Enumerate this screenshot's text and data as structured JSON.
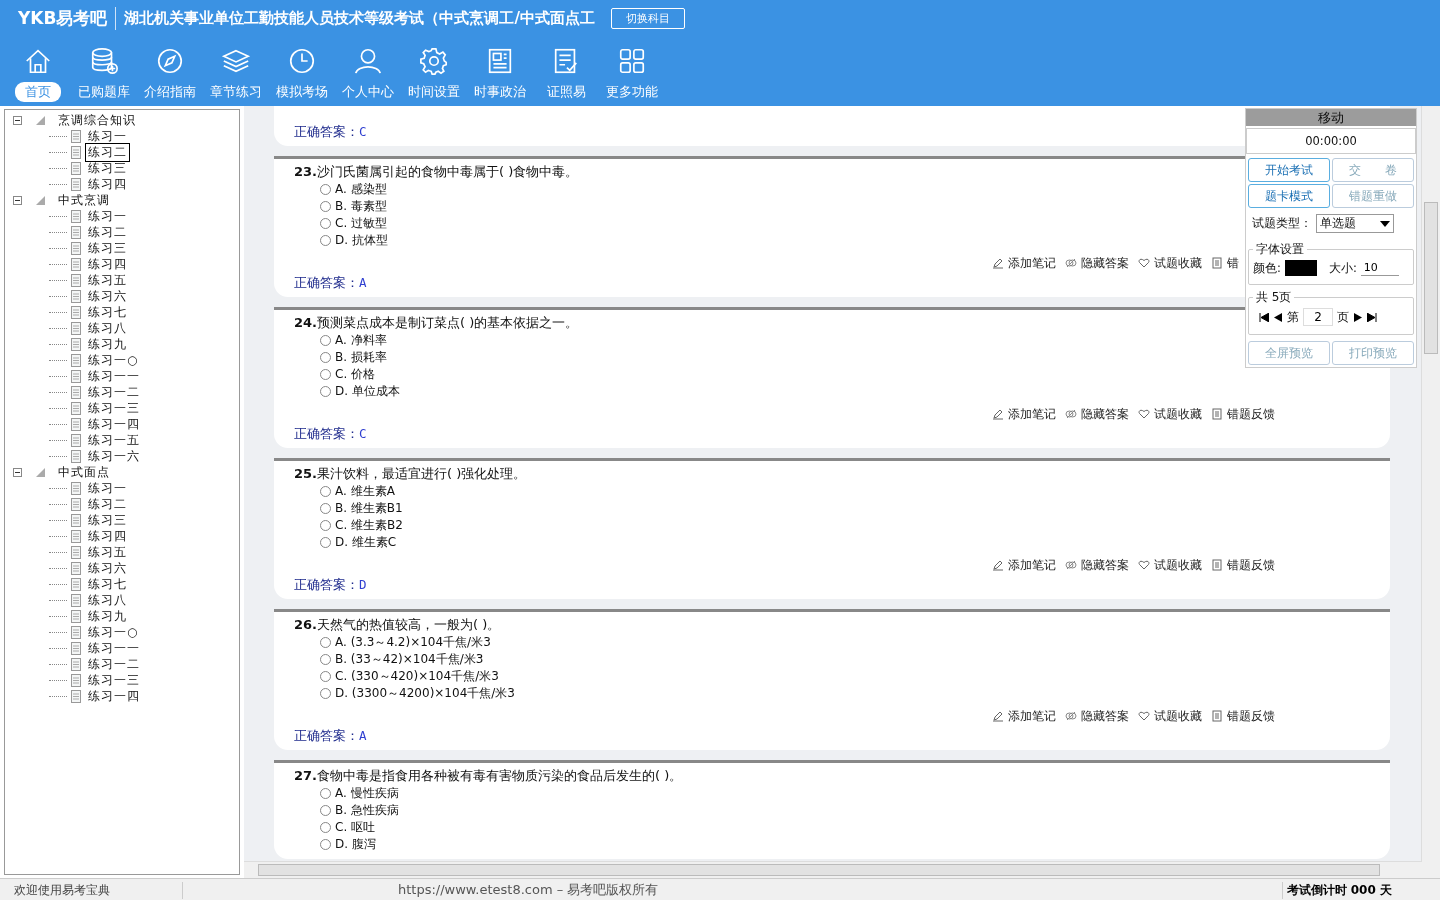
{
  "header": {
    "logo": "YKB易考吧",
    "title": "湖北机关事业单位工勤技能人员技术等级考试（中式烹调工/中式面点工",
    "switch_button": "切换科目"
  },
  "nav": [
    {
      "label": "首页",
      "selected": true
    },
    {
      "label": "已购题库",
      "selected": false
    },
    {
      "label": "介绍指南",
      "selected": false
    },
    {
      "label": "章节练习",
      "selected": false
    },
    {
      "label": "模拟考场",
      "selected": false
    },
    {
      "label": "个人中心",
      "selected": false
    },
    {
      "label": "时间设置",
      "selected": false
    },
    {
      "label": "时事政治",
      "selected": false
    },
    {
      "label": "证照易",
      "selected": false
    },
    {
      "label": "更多功能",
      "selected": false
    }
  ],
  "tree": [
    {
      "label": "烹调综合知识",
      "expanded": true,
      "children": [
        {
          "label": "练习一",
          "selected": false
        },
        {
          "label": "练习二",
          "selected": true
        },
        {
          "label": "练习三",
          "selected": false
        },
        {
          "label": "练习四",
          "selected": false
        }
      ]
    },
    {
      "label": "中式烹调",
      "expanded": true,
      "children": [
        {
          "label": "练习一",
          "selected": false
        },
        {
          "label": "练习二",
          "selected": false
        },
        {
          "label": "练习三",
          "selected": false
        },
        {
          "label": "练习四",
          "selected": false
        },
        {
          "label": "练习五",
          "selected": false
        },
        {
          "label": "练习六",
          "selected": false
        },
        {
          "label": "练习七",
          "selected": false
        },
        {
          "label": "练习八",
          "selected": false
        },
        {
          "label": "练习九",
          "selected": false
        },
        {
          "label": "练习一○",
          "selected": false
        },
        {
          "label": "练习一一",
          "selected": false
        },
        {
          "label": "练习一二",
          "selected": false
        },
        {
          "label": "练习一三",
          "selected": false
        },
        {
          "label": "练习一四",
          "selected": false
        },
        {
          "label": "练习一五",
          "selected": false
        },
        {
          "label": "练习一六",
          "selected": false
        }
      ]
    },
    {
      "label": "中式面点",
      "expanded": true,
      "children": [
        {
          "label": "练习一",
          "selected": false
        },
        {
          "label": "练习二",
          "selected": false
        },
        {
          "label": "练习三",
          "selected": false
        },
        {
          "label": "练习四",
          "selected": false
        },
        {
          "label": "练习五",
          "selected": false
        },
        {
          "label": "练习六",
          "selected": false
        },
        {
          "label": "练习七",
          "selected": false
        },
        {
          "label": "练习八",
          "selected": false
        },
        {
          "label": "练习九",
          "selected": false
        },
        {
          "label": "练习一○",
          "selected": false
        },
        {
          "label": "练习一一",
          "selected": false
        },
        {
          "label": "练习一二",
          "selected": false
        },
        {
          "label": "练习一三",
          "selected": false
        },
        {
          "label": "练习一四",
          "selected": false
        }
      ]
    }
  ],
  "questions": [
    {
      "answer_label": "正确答案：",
      "answer": "C"
    },
    {
      "number": "23.",
      "text": "沙门氏菌属引起的食物中毒属于( )食物中毒。",
      "options": [
        {
          "label": "A. 感染型",
          "selected": false
        },
        {
          "label": "B. 毒素型",
          "selected": false
        },
        {
          "label": "C. 过敏型",
          "selected": false
        },
        {
          "label": "D. 抗体型",
          "selected": false
        }
      ],
      "actions": [
        "添加笔记",
        "隐藏答案",
        "试题收藏",
        "错"
      ],
      "answer_label": "正确答案：",
      "answer": "A"
    },
    {
      "number": "24.",
      "text": "预测菜点成本是制订菜点( )的基本依据之一。",
      "options": [
        {
          "label": "A. 净料率",
          "selected": false
        },
        {
          "label": "B. 损耗率",
          "selected": false
        },
        {
          "label": "C. 价格",
          "selected": false
        },
        {
          "label": "D. 单位成本",
          "selected": false
        }
      ],
      "actions": [
        "添加笔记",
        "隐藏答案",
        "试题收藏",
        "错题反馈"
      ],
      "answer_label": "正确答案：",
      "answer": "C"
    },
    {
      "number": "25.",
      "text": "果汁饮料，最适宜进行( )强化处理。",
      "options": [
        {
          "label": "A. 维生素A",
          "selected": false
        },
        {
          "label": "B. 维生素B1",
          "selected": false
        },
        {
          "label": "C. 维生素B2",
          "selected": false
        },
        {
          "label": "D. 维生素C",
          "selected": false
        }
      ],
      "actions": [
        "添加笔记",
        "隐藏答案",
        "试题收藏",
        "错题反馈"
      ],
      "answer_label": "正确答案：",
      "answer": "D"
    },
    {
      "number": "26.",
      "text": "天然气的热值较高，一般为( )。",
      "options": [
        {
          "label": "A. (3.3～4.2)×104千焦/米3",
          "selected": false
        },
        {
          "label": "B. (33～42)×104千焦/米3",
          "selected": false
        },
        {
          "label": "C. (330～420)×104千焦/米3",
          "selected": false
        },
        {
          "label": "D. (3300～4200)×104千焦/米3",
          "selected": false
        }
      ],
      "actions": [
        "添加笔记",
        "隐藏答案",
        "试题收藏",
        "错题反馈"
      ],
      "answer_label": "正确答案：",
      "answer": "A"
    },
    {
      "number": "27.",
      "text": "食物中毒是指食用各种被有毒有害物质污染的食品后发生的( )。",
      "options": [
        {
          "label": "A. 慢性疾病",
          "selected": false
        },
        {
          "label": "B. 急性疾病",
          "selected": false
        },
        {
          "label": "C. 呕吐",
          "selected": false
        },
        {
          "label": "D. 腹泻",
          "selected": false
        }
      ]
    }
  ],
  "panel": {
    "title": "移动",
    "timer": "00:00:00",
    "buttons": [
      {
        "label": "开始考试",
        "disabled": false
      },
      {
        "label": "交　　卷",
        "disabled": true
      },
      {
        "label": "题卡模式",
        "disabled": false
      },
      {
        "label": "错题重做",
        "disabled": true
      }
    ],
    "type_label": "试题类型：",
    "type_value": "单选题",
    "font_legend": "字体设置",
    "color_label": "颜色:",
    "size_label": "大小:",
    "size_value": "10",
    "pages_legend": "共 5页",
    "page_prefix": "第",
    "page_value": "2",
    "page_suffix": "页",
    "bottom_buttons": [
      "全屏预览",
      "打印预览"
    ]
  },
  "status_bar": {
    "welcome": "欢迎使用易考宝典",
    "copyright": "https://www.etest8.com – 易考吧版权所有",
    "countdown": "考试倒计时 000 天"
  }
}
